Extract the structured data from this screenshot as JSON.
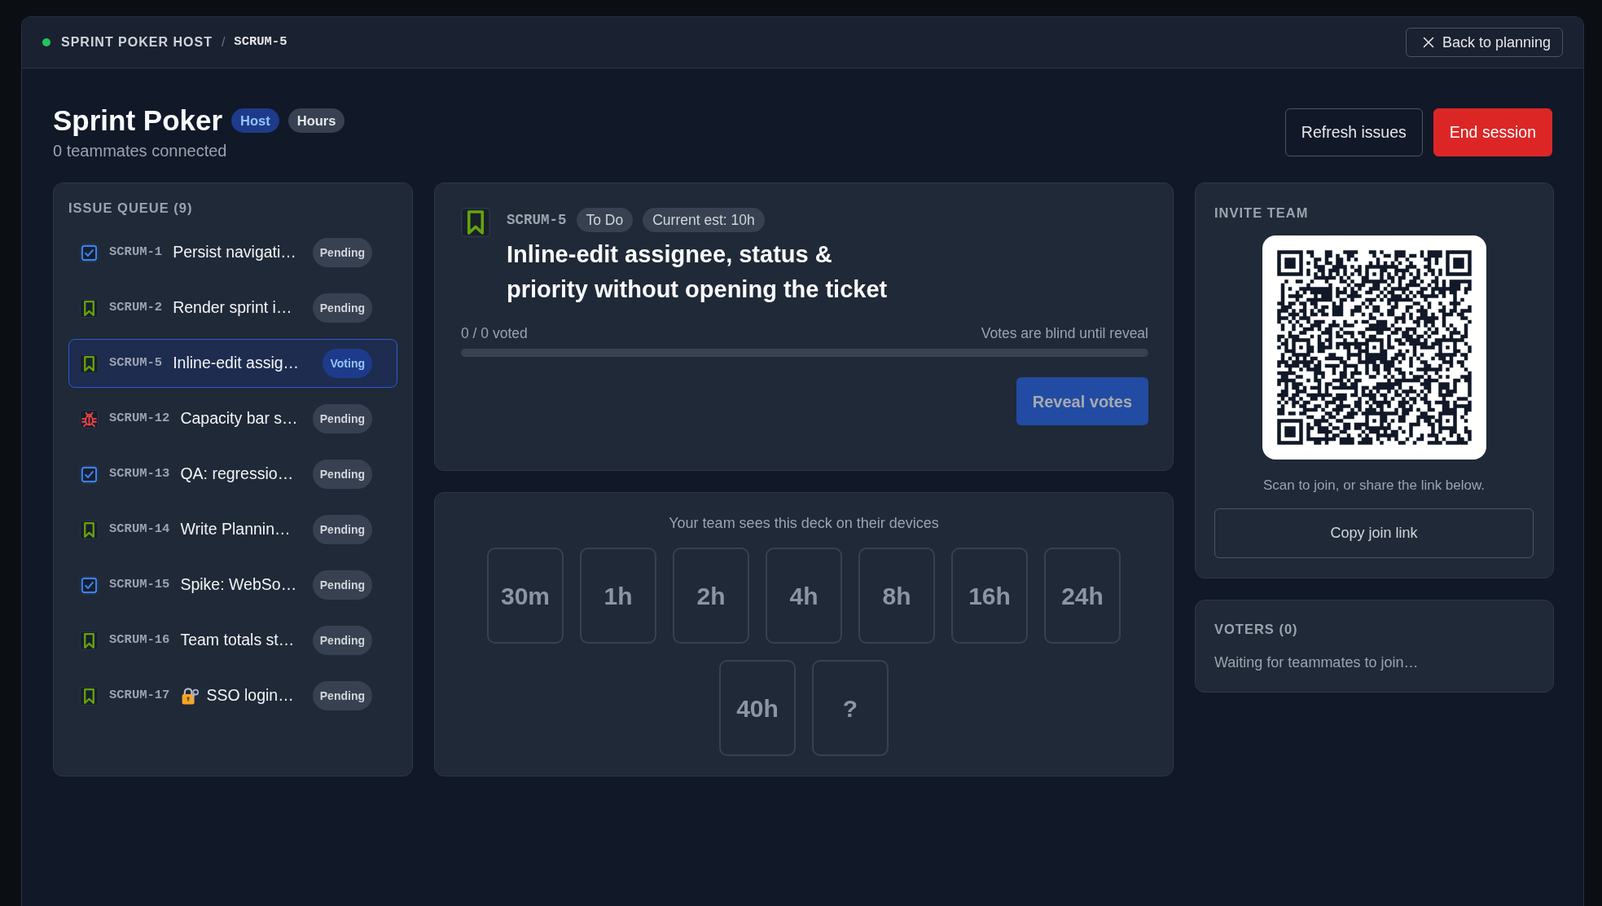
{
  "header": {
    "title": "SPRINT POKER HOST",
    "separator": "/",
    "issue_key": "SCRUM-5",
    "back_button": {
      "label": "Back to planning"
    }
  },
  "session": {
    "title": "Sprint Poker",
    "badges": [
      {
        "text": "Host",
        "kind": "accent"
      },
      {
        "text": "Hours",
        "kind": "neutral"
      }
    ],
    "subtitle": "0 teammates connected",
    "actions": [
      {
        "label": "Refresh issues",
        "kind": "outline"
      },
      {
        "label": "End session",
        "kind": "danger"
      }
    ]
  },
  "issue_queue": {
    "title": "ISSUE QUEUE (9)",
    "items": [
      {
        "kind": "task",
        "key": "SCRUM-1",
        "lock": false,
        "title": "Persist navigati…",
        "status": {
          "text": "Pending",
          "kind": "neutral"
        },
        "selected": false
      },
      {
        "kind": "story",
        "key": "SCRUM-2",
        "lock": false,
        "title": "Render sprint i…",
        "status": {
          "text": "Pending",
          "kind": "neutral"
        },
        "selected": false
      },
      {
        "kind": "story",
        "key": "SCRUM-5",
        "lock": false,
        "title": "Inline-edit assig…",
        "status": {
          "text": "Voting",
          "kind": "active"
        },
        "selected": true
      },
      {
        "kind": "bug",
        "key": "SCRUM-12",
        "lock": false,
        "title": "Capacity bar s…",
        "status": {
          "text": "Pending",
          "kind": "neutral"
        },
        "selected": false
      },
      {
        "kind": "task",
        "key": "SCRUM-13",
        "lock": false,
        "title": "QA: regressio…",
        "status": {
          "text": "Pending",
          "kind": "neutral"
        },
        "selected": false
      },
      {
        "kind": "story",
        "key": "SCRUM-14",
        "lock": false,
        "title": "Write Plannin…",
        "status": {
          "text": "Pending",
          "kind": "neutral"
        },
        "selected": false
      },
      {
        "kind": "task",
        "key": "SCRUM-15",
        "lock": false,
        "title": "Spike: WebSo…",
        "status": {
          "text": "Pending",
          "kind": "neutral"
        },
        "selected": false
      },
      {
        "kind": "story",
        "key": "SCRUM-16",
        "lock": false,
        "title": "Team totals st…",
        "status": {
          "text": "Pending",
          "kind": "neutral"
        },
        "selected": false
      },
      {
        "kind": "story",
        "key": "SCRUM-17",
        "lock": true,
        "title": "SSO login…",
        "status": {
          "text": "Pending",
          "kind": "neutral"
        },
        "selected": false
      }
    ]
  },
  "current_issue": {
    "kind": "story",
    "key": "SCRUM-5",
    "tags": [
      "To Do",
      "Current est: 10h"
    ],
    "title": "Inline-edit assignee, status & priority without opening the ticket",
    "voted": "0 / 0 voted",
    "note": "Votes are blind until reveal",
    "progress": {
      "level": 0
    },
    "reveal_button": {
      "label": "Reveal votes",
      "disabled": true
    }
  },
  "deck": {
    "caption": "Your team sees this deck on their devices",
    "cards": [
      {
        "label": "30m"
      },
      {
        "label": "1h"
      },
      {
        "label": "2h"
      },
      {
        "label": "4h"
      },
      {
        "label": "8h"
      },
      {
        "label": "16h"
      },
      {
        "label": "24h"
      },
      {
        "label": "40h"
      },
      {
        "label": "?"
      }
    ]
  },
  "invite": {
    "title": "INVITE TEAM",
    "caption": "Scan to join, or share the link below.",
    "copy_button": {
      "label": "Copy join link"
    }
  },
  "voters": {
    "title": "VOTERS (0)",
    "empty_text": "Waiting for teammates to join…"
  }
}
